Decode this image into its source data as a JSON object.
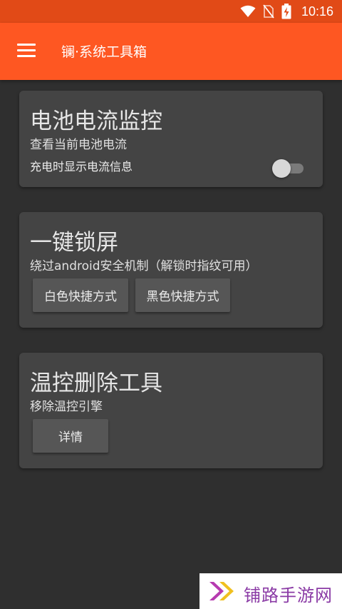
{
  "status_bar": {
    "time": "10:16"
  },
  "app_bar": {
    "title": "镧·系统工具箱"
  },
  "cards": [
    {
      "title": "电池电流监控",
      "subtitle": "查看当前电池电流",
      "toggle_label": "充电时显示电流信息",
      "toggle_on": false
    },
    {
      "title": "一键锁屏",
      "subtitle": "绕过android安全机制（解锁时指纹可用）",
      "buttons": [
        "白色快捷方式",
        "黑色快捷方式"
      ]
    },
    {
      "title": "温控删除工具",
      "subtitle": "移除温控引擎",
      "buttons": [
        "详情"
      ]
    }
  ],
  "watermark": {
    "text": "铺路手游网"
  },
  "colors": {
    "status_bar": "#e14a17",
    "app_bar": "#fe5722",
    "background": "#2f2f2f",
    "card": "#444444",
    "button": "#565656"
  }
}
